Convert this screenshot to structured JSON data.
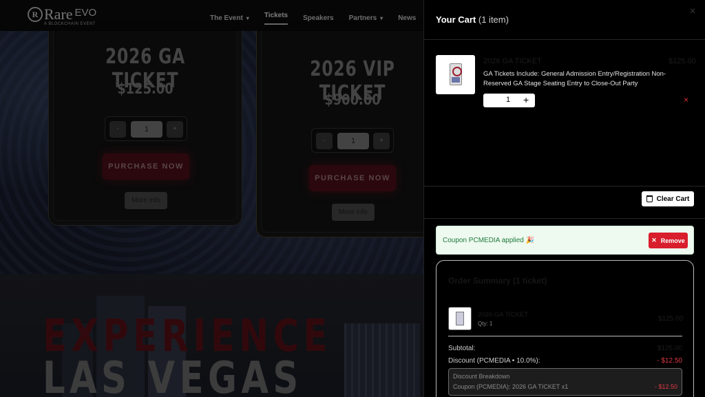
{
  "nav": {
    "logo_text": "Rare",
    "logo_suffix": "EVO",
    "logo_subtitle": "A BLOCKCHAIN EVENT",
    "items": [
      {
        "label": "The Event"
      },
      {
        "label": "Tickets"
      },
      {
        "label": "Speakers"
      },
      {
        "label": "Partners"
      },
      {
        "label": "News"
      }
    ]
  },
  "tickets": [
    {
      "title": "2026 GA TICKET",
      "price": "$125.00",
      "qty": "1",
      "minus": "-",
      "plus": "+",
      "purchase": "PURCHASE NOW",
      "more_info": "More info"
    },
    {
      "title": "2026 VIP TICKET",
      "price": "$900.00",
      "qty": "1",
      "minus": "-",
      "plus": "+",
      "purchase": "PURCHASE NOW",
      "more_info": "More info"
    }
  ],
  "hero": {
    "line1": "EXPERIENCE",
    "line2": "LAS VEGAS"
  },
  "cart": {
    "title": "Your Cart",
    "count": "(1 item)",
    "item": {
      "name": "2026 GA TICKET",
      "price": "$125.00",
      "description": "GA Tickets Include: General Admission Entry/Registration Non-Reserved GA Stage Seating Entry to Close-Out Party",
      "qty": "1",
      "plus": "+",
      "remove": "×"
    },
    "clear_label": "Clear Cart",
    "coupon": {
      "text": "Coupon PCMEDIA applied 🎉",
      "remove_label": "Remove"
    },
    "summary": {
      "title": "Order Summary (1 ticket)",
      "item_name": "2026 GA TICKET",
      "item_qty": "Qty: 1",
      "item_price": "$125.00",
      "subtotal_label": "Subtotal:",
      "subtotal_value": "$125.00",
      "discount_label": "Discount (PCMEDIA • 10.0%):",
      "discount_value": "- $12.50",
      "breakdown_title": "Discount Breakdown",
      "breakdown_line": "Coupon (PCMEDIA): 2026 GA TICKET x1",
      "breakdown_amount": "- $12.50"
    }
  },
  "colors": {
    "accent_red": "#d81e2c",
    "coupon_green": "#1e7a3a"
  }
}
